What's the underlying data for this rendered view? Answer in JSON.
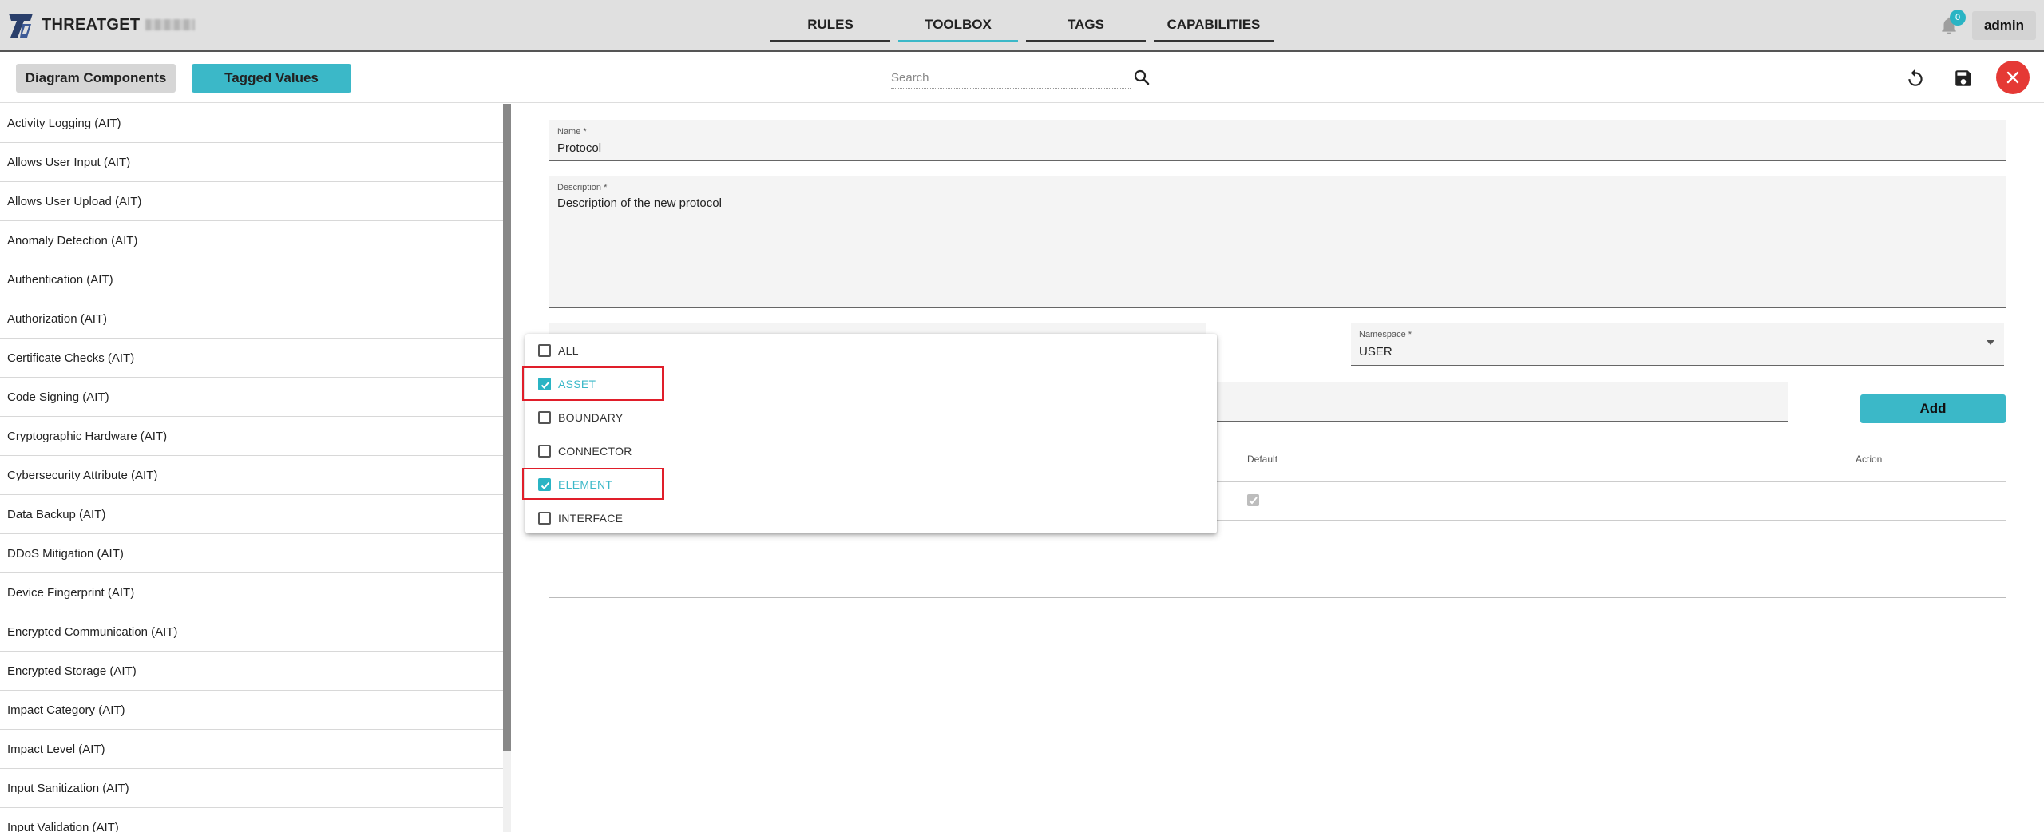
{
  "app": {
    "brand": "THREATGET",
    "nav": [
      {
        "label": "RULES"
      },
      {
        "label": "TOOLBOX"
      },
      {
        "label": "TAGS"
      },
      {
        "label": "CAPABILITIES"
      }
    ],
    "active_tab": "TOOLBOX",
    "notification_count": "0",
    "user": "admin"
  },
  "toolbar": {
    "diagram_components": "Diagram Components",
    "tagged_values": "Tagged Values",
    "search_placeholder": "Search"
  },
  "sidebar": {
    "items": [
      "Activity Logging (AIT)",
      "Allows User Input (AIT)",
      "Allows User Upload (AIT)",
      "Anomaly Detection (AIT)",
      "Authentication (AIT)",
      "Authorization (AIT)",
      "Certificate Checks (AIT)",
      "Code Signing (AIT)",
      "Cryptographic Hardware (AIT)",
      "Cybersecurity Attribute (AIT)",
      "Data Backup (AIT)",
      "DDoS Mitigation (AIT)",
      "Device Fingerprint (AIT)",
      "Encrypted Communication (AIT)",
      "Encrypted Storage (AIT)",
      "Impact Category (AIT)",
      "Impact Level (AIT)",
      "Input Sanitization (AIT)",
      "Input Validation (AIT)"
    ]
  },
  "form": {
    "name_label": "Name *",
    "name_value": "Protocol",
    "description_label": "Description *",
    "description_value": "Description of the new protocol",
    "namespace_label": "Namespace *",
    "namespace_value": "USER",
    "add_button": "Add",
    "table_headers": {
      "default": "Default",
      "action": "Action"
    },
    "default_checked": true
  },
  "dropdown": {
    "options": [
      {
        "label": "ALL",
        "checked": false
      },
      {
        "label": "ASSET",
        "checked": true
      },
      {
        "label": "BOUNDARY",
        "checked": false
      },
      {
        "label": "CONNECTOR",
        "checked": false
      },
      {
        "label": "ELEMENT",
        "checked": true
      },
      {
        "label": "INTERFACE",
        "checked": false
      }
    ]
  },
  "colors": {
    "accent": "#3bb8c8",
    "close": "#e53935",
    "highlight": "#e01e2a"
  }
}
